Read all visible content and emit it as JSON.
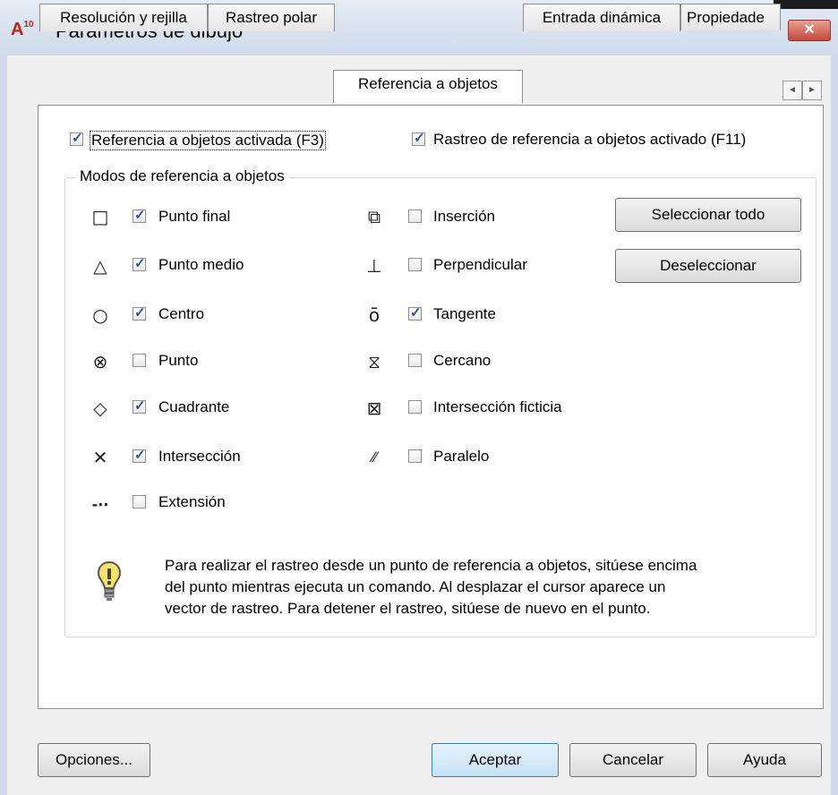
{
  "window": {
    "logo_text": "A",
    "logo_sub": "10",
    "title": "Parámetros de dibujo",
    "close_glyph": "✕"
  },
  "tabs": [
    {
      "label": "Resolución y rejilla",
      "active": false
    },
    {
      "label": "Rastreo polar",
      "active": false
    },
    {
      "label": "Referencia a objetos",
      "active": true
    },
    {
      "label": "Entrada dinámica",
      "active": false
    },
    {
      "label": "Propiedade",
      "active": false
    }
  ],
  "tab_scroll": {
    "left": "◄",
    "right": "►"
  },
  "top_checks": {
    "osnap_on": {
      "label": "Referencia a objetos activada (F3)",
      "checked": true
    },
    "tracking_on": {
      "label": "Rastreo de referencia a objetos activado (F11)",
      "checked": true
    }
  },
  "group": {
    "title": "Modos de referencia a objetos",
    "left_modes": [
      {
        "symbol": "□",
        "label": "Punto final",
        "checked": true,
        "icon": "endpoint-icon"
      },
      {
        "symbol": "△",
        "label": "Punto medio",
        "checked": true,
        "icon": "midpoint-icon"
      },
      {
        "symbol": "○",
        "label": "Centro",
        "checked": true,
        "icon": "center-icon"
      },
      {
        "symbol": "⊗",
        "label": "Punto",
        "checked": false,
        "icon": "node-icon"
      },
      {
        "symbol": "◇",
        "label": "Cuadrante",
        "checked": true,
        "icon": "quadrant-icon"
      },
      {
        "symbol": "✕",
        "label": "Intersección",
        "checked": true,
        "icon": "intersection-icon"
      },
      {
        "symbol": "-··",
        "label": "Extensión",
        "checked": false,
        "icon": "extension-icon"
      }
    ],
    "right_modes": [
      {
        "symbol": "⧉",
        "label": "Inserción",
        "checked": false,
        "icon": "insertion-icon"
      },
      {
        "symbol": "⊥",
        "label": "Perpendicular",
        "checked": false,
        "icon": "perpendicular-icon"
      },
      {
        "symbol": "ō",
        "label": "Tangente",
        "checked": true,
        "icon": "tangent-icon"
      },
      {
        "symbol": "⧖",
        "label": "Cercano",
        "checked": false,
        "icon": "nearest-icon"
      },
      {
        "symbol": "⊠",
        "label": "Intersección ficticia",
        "checked": false,
        "icon": "apparent-intersection-icon"
      },
      {
        "symbol": "⁄⁄",
        "label": "Paralelo",
        "checked": false,
        "icon": "parallel-icon"
      }
    ],
    "select_all": "Seleccionar todo",
    "deselect": "Deseleccionar",
    "hint_lines": [
      "Para realizar el rastreo desde un punto de referencia a objetos, sitúese encima",
      "del punto mientras ejecuta un comando. Al desplazar el cursor aparece un",
      "vector de rastreo. Para detener el rastreo, sitúese de nuevo en el punto."
    ]
  },
  "footer": {
    "options": "Opciones...",
    "accept": "Aceptar",
    "cancel": "Cancelar",
    "help": "Ayuda"
  }
}
